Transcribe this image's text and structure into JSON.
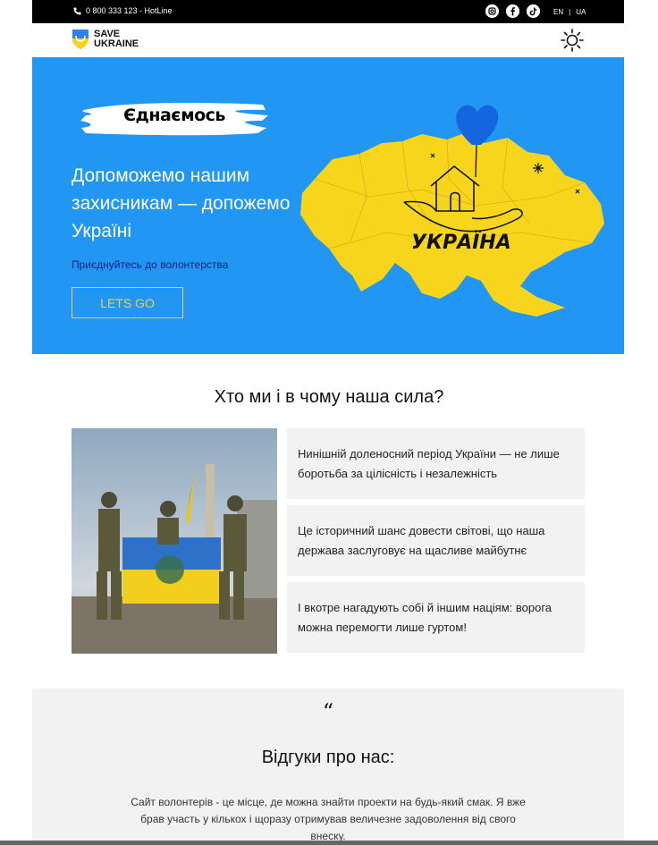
{
  "topbar": {
    "hotline": "0 800 333 123 - HotLine",
    "social_icons": [
      "instagram-icon",
      "facebook-icon",
      "tiktok-icon"
    ],
    "lang_en": "EN",
    "lang_sep": "|",
    "lang_ua": "UA"
  },
  "header": {
    "logo_line1": "SAVE",
    "logo_line2": "UKRAINE",
    "theme_icon": "sun-icon"
  },
  "hero": {
    "badge": "Єднаємось",
    "title": "Допоможемо нашим захисникам — допожемо Україні",
    "subtitle": "Приєднуйтесь до волонтерства",
    "button": "LETS GO",
    "map_caption": "УКРАЇНА",
    "colors": {
      "background": "#2196f3",
      "map": "#f7d51d",
      "heart": "#1565e0",
      "button": "#f4d03f"
    }
  },
  "about": {
    "title": "Хто ми і в чому наша сила?",
    "cards": [
      "Нинішній доленосний період України — не лише боротьба за цілісність і незалежність",
      "Це історичний шанс довести світові, що наша держава заслуговує на щасливе майбутнє",
      "І вкотре нагадують собі й іншим націям: ворога можна перемогти лише гуртом!"
    ]
  },
  "reviews": {
    "quote_mark": "“",
    "title": "Відгуки про нас:",
    "text": "Сайт волонтерів - це місце, де можна знайти проекти на будь-який смак. Я вже брав участь у кількох і щоразу отримував величезне задоволення від свого внеску."
  }
}
